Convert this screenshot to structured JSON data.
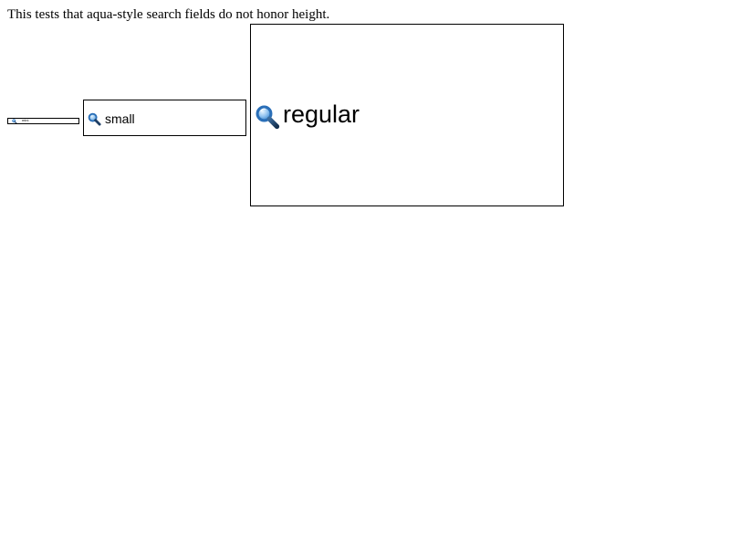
{
  "description": "This tests that aqua-style search fields do not honor height.",
  "fields": {
    "mini": {
      "text": "mini",
      "icon": "magnifier-icon"
    },
    "small": {
      "text": "small",
      "icon": "magnifier-icon"
    },
    "regular": {
      "text": "regular",
      "icon": "magnifier-icon"
    }
  },
  "colors": {
    "icon_lens": "#2a6fb8",
    "icon_lens_light": "#8fc2f0",
    "icon_handle": "#1f3f66",
    "border": "#000000"
  }
}
